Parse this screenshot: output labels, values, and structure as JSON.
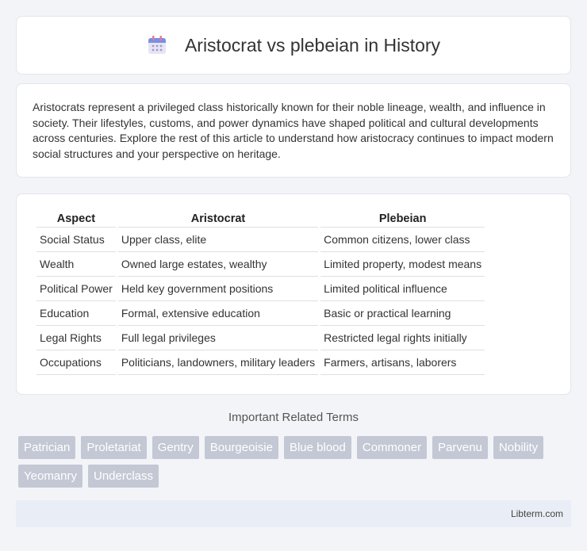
{
  "header": {
    "title": "Aristocrat vs plebeian in History",
    "icon": "calendar-icon"
  },
  "intro": {
    "text": "Aristocrats represent a privileged class historically known for their noble lineage, wealth, and influence in society. Their lifestyles, customs, and power dynamics have shaped political and cultural developments across centuries. Explore the rest of this article to understand how aristocracy continues to impact modern social structures and your perspective on heritage."
  },
  "table": {
    "headers": [
      "Aspect",
      "Aristocrat",
      "Plebeian"
    ],
    "rows": [
      [
        "Social Status",
        "Upper class, elite",
        "Common citizens, lower class"
      ],
      [
        "Wealth",
        "Owned large estates, wealthy",
        "Limited property, modest means"
      ],
      [
        "Political Power",
        "Held key government positions",
        "Limited political influence"
      ],
      [
        "Education",
        "Formal, extensive education",
        "Basic or practical learning"
      ],
      [
        "Legal Rights",
        "Full legal privileges",
        "Restricted legal rights initially"
      ],
      [
        "Occupations",
        "Politicians, landowners, military leaders",
        "Farmers, artisans, laborers"
      ]
    ]
  },
  "related": {
    "heading": "Important Related Terms",
    "tags": [
      "Patrician",
      "Proletariat",
      "Gentry",
      "Bourgeoisie",
      "Blue blood",
      "Commoner",
      "Parvenu",
      "Nobility",
      "Yeomanry",
      "Underclass"
    ]
  },
  "footer": {
    "site": "Libterm.com"
  },
  "colors": {
    "tag_bg": "#c3c8d4",
    "footer_bg": "#e9eef6",
    "page_bg": "#f3f4f7"
  }
}
